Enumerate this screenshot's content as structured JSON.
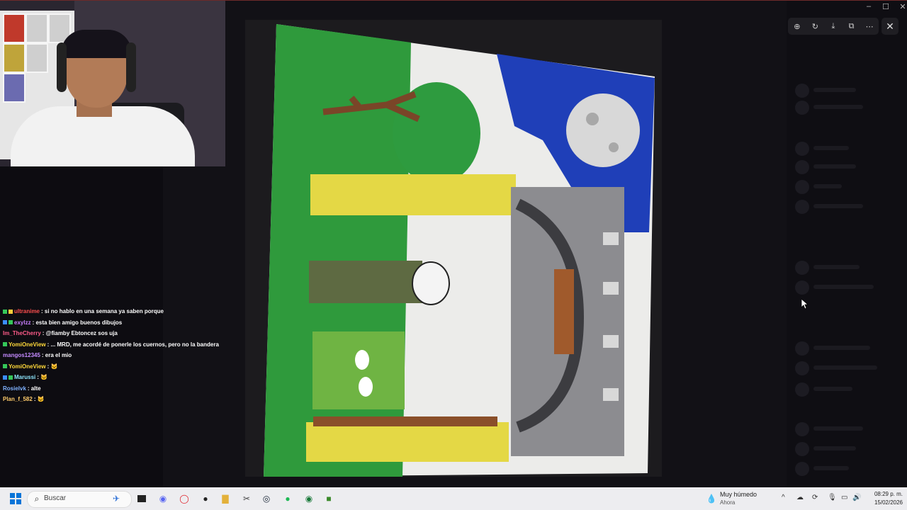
{
  "window": {
    "minimize": "–",
    "maximize": "☐",
    "close": "✕"
  },
  "viewer": {
    "toolbar": [
      {
        "name": "zoom-icon",
        "glyph": "⊕"
      },
      {
        "name": "rotate-icon",
        "glyph": "↻"
      },
      {
        "name": "download-icon",
        "glyph": "⤓"
      },
      {
        "name": "open-external-icon",
        "glyph": "⧉"
      },
      {
        "name": "more-icon",
        "glyph": "⋯"
      }
    ],
    "close": "✕"
  },
  "chat": [
    {
      "name": "ultranime",
      "color": "#ff4f4f",
      "msg": ": si no hablo en una semana ya saben porque",
      "badges": [
        "#35c75a",
        "#ffce3a"
      ]
    },
    {
      "name": "exylzz",
      "color": "#c77dff",
      "msg": ": esta bien amigo buenos dibujos",
      "badges": [
        "#3a8dff",
        "#35c75a"
      ]
    },
    {
      "name": "Im_TheCherry",
      "color": "#ff5c8a",
      "msg": ": @fiamby Ebtoncez sos uja",
      "badges": []
    },
    {
      "name": "YomiOneView",
      "color": "#ffd93a",
      "msg": ": ... MRD, me acordé de ponerle los cuernos, pero no la bandera",
      "badges": [
        "#35c75a"
      ]
    },
    {
      "name": "mangos12345",
      "color": "#c48bff",
      "msg": ": era el mio",
      "badges": []
    },
    {
      "name": "YomiOneView",
      "color": "#ffd93a",
      "msg": ": 🐱",
      "badges": [
        "#35c75a"
      ]
    },
    {
      "name": "Marussi",
      "color": "#8fe8ff",
      "msg": ": 🐱",
      "badges": [
        "#3a8dff",
        "#35c75a"
      ]
    },
    {
      "name": "Rosielvk",
      "color": "#7fb2ff",
      "msg": ": alte",
      "badges": []
    },
    {
      "name": "Plan_f_582",
      "color": "#ffcb6b",
      "msg": ": 🐱",
      "badges": []
    }
  ],
  "taskbar": {
    "search_placeholder": "Buscar",
    "weather_title": "Muy húmedo",
    "weather_sub": "Ahora",
    "time": "08:29 p. m.",
    "date": "15/02/2026"
  },
  "colors": {
    "sky": "#1f3fb8",
    "grass": "#2f9a3c",
    "tree": "#2f9b3e",
    "pillar": "#e4d845",
    "arch": "#8c8c90"
  }
}
